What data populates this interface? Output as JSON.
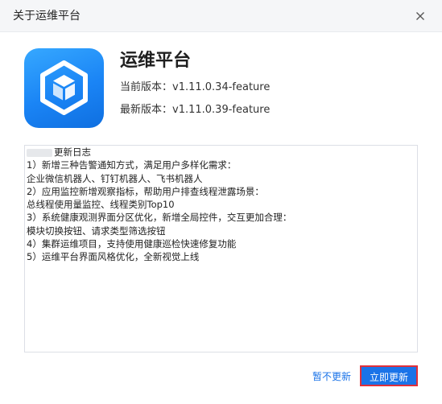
{
  "dialog": {
    "title": "关于运维平台",
    "close_icon": "close-icon"
  },
  "app": {
    "icon": "hexagon-cube-logo",
    "name": "运维平台",
    "current_version": "当前版本：v1.11.0.34-feature",
    "latest_version": "最新版本：v1.11.0.39-feature"
  },
  "changelog": {
    "heading": "更新日志",
    "lines": [
      "1）新增三种告警通知方式，满足用户多样化需求：",
      "企业微信机器人、钉钉机器人、飞书机器人",
      "2）应用监控新增观察指标，帮助用户排查线程泄露场景：",
      "总线程使用量监控、线程类别Top10",
      "3）系统健康观测界面分区优化，新增全局控件，交互更加合理：",
      "模块切换按钮、请求类型筛选按钮",
      "4）集群运维项目，支持使用健康巡检快速修复功能",
      "5）运维平台界面风格优化，全新视觉上线"
    ]
  },
  "actions": {
    "later_label": "暂不更新",
    "update_label": "立即更新"
  },
  "colors": {
    "accent": "#1a73e8",
    "highlight_border": "#e0303a",
    "icon_gradient_top": "#36a8ff",
    "icon_gradient_bottom": "#0f6fe0"
  }
}
